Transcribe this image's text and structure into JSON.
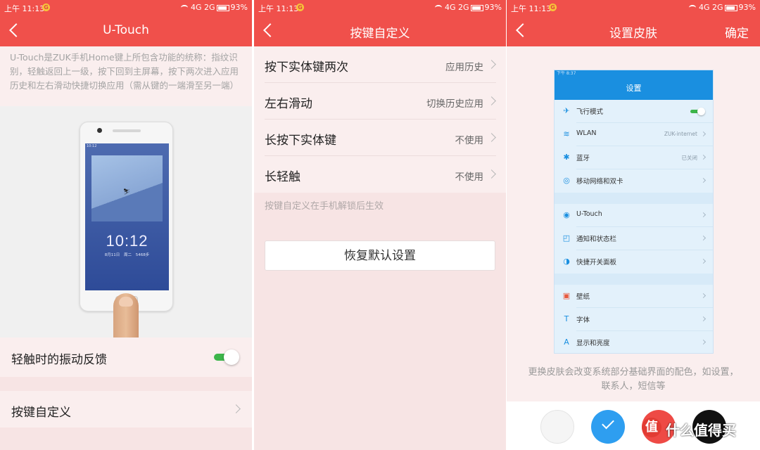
{
  "status": {
    "time": "上午 11:13",
    "notif": "G",
    "network": "4G  2G",
    "battery": "93%",
    "battery_level": 0.93
  },
  "panel1": {
    "title": "U-Touch",
    "description": "U-Touch是ZUK手机Home键上所包含功能的统称：指纹识别，轻触返回上一级，按下回到主屏幕，按下两次进入应用历史和左右滑动快捷切换应用（需从键的一端滑至另一端）",
    "phone_clock": "10:12",
    "phone_date": "8月11日  周二  5468步",
    "phone_status": "10:12",
    "vibration_label": "轻触时的振动反馈",
    "vibration_on": true,
    "key_custom_label": "按键自定义"
  },
  "panel2": {
    "title": "按键自定义",
    "items": [
      {
        "label": "按下实体键两次",
        "value": "应用历史"
      },
      {
        "label": "左右滑动",
        "value": "切换历史应用"
      },
      {
        "label": "长按下实体键",
        "value": "不使用"
      },
      {
        "label": "长轻触",
        "value": "不使用"
      }
    ],
    "note": "按键自定义在手机解锁后生效",
    "restore_label": "恢复默认设置"
  },
  "panel3": {
    "title": "设置皮肤",
    "confirm_label": "确定",
    "preview": {
      "status": "下午 8:37",
      "title": "设置",
      "rows": [
        {
          "icon": "✈",
          "label": "飞行模式",
          "value": "",
          "toggle": true
        },
        {
          "icon": "≋",
          "label": "WLAN",
          "value": "ZUK-internet"
        },
        {
          "icon": "✱",
          "label": "蓝牙",
          "value": "已关闭"
        },
        {
          "icon": "◎",
          "label": "移动网络和双卡",
          "value": ""
        },
        {
          "icon": "◉",
          "label": "U-Touch",
          "value": ""
        },
        {
          "icon": "◰",
          "label": "通知和状态栏",
          "value": ""
        },
        {
          "icon": "◑",
          "label": "快捷开关面板",
          "value": ""
        },
        {
          "icon": "▣",
          "label": "壁纸",
          "value": ""
        },
        {
          "icon": "T",
          "label": "字体",
          "value": ""
        },
        {
          "icon": "A",
          "label": "显示和亮度",
          "value": ""
        }
      ]
    },
    "skin_description": "更换皮肤会改变系统部分基础界面的配色，如设置，联系人，短信等",
    "swatches": [
      {
        "name": "white",
        "color": "#f5f5f5",
        "selected": false
      },
      {
        "name": "blue",
        "color": "#2e9ef0",
        "selected": true
      },
      {
        "name": "red",
        "color": "#ee4a45",
        "selected": false
      },
      {
        "name": "black",
        "color": "#111111",
        "selected": false
      }
    ],
    "watermark_logo": "值",
    "watermark_text": "什么值得买"
  },
  "colors": {
    "accent": "#f0504b",
    "toggle_on": "#3cb54a",
    "skin_blue": "#1a8fe0"
  }
}
